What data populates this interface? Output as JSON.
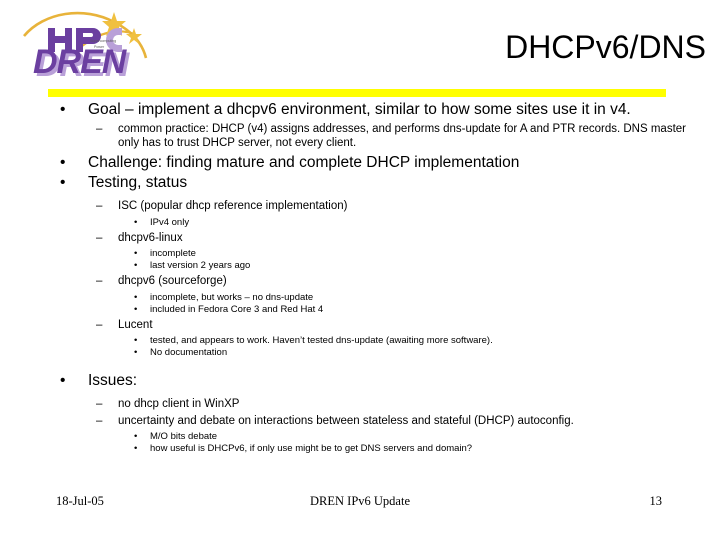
{
  "slide": {
    "title": "DHCPv6/DNS",
    "logo": {
      "primary_text": "DREN",
      "secondary_text": "HPC",
      "tagline_line1": "Supercomputing",
      "tagline_line2": "Power",
      "arc_color": "#E8B33A",
      "star_color": "#F0C040",
      "letter_color": "#6B3FA0",
      "letter_shadow_color": "#B9A0D8"
    },
    "rule_color": "#ffff00",
    "bullets": [
      {
        "level": 1,
        "marker": "•",
        "text": "Goal – implement a dhcpv6 environment, similar to how some sites use it in v4."
      },
      {
        "level": 2,
        "marker": "–",
        "text": "common practice:  DHCP (v4) assigns addresses, and performs dns-update for A and PTR records.  DNS master only has to trust DHCP server, not every client."
      },
      {
        "level": 1,
        "marker": "•",
        "text": "Challenge:  finding mature and complete DHCP implementation"
      },
      {
        "level": 1,
        "marker": "•",
        "text": "Testing, status"
      },
      {
        "level": 2,
        "marker": "–",
        "text": "ISC (popular dhcp reference implementation)"
      },
      {
        "level": 3,
        "marker": "•",
        "text": "IPv4 only"
      },
      {
        "level": 2,
        "marker": "–",
        "text": "dhcpv6-linux"
      },
      {
        "level": 3,
        "marker": "•",
        "text": "incomplete"
      },
      {
        "level": 3,
        "marker": "•",
        "text": "last version 2 years ago"
      },
      {
        "level": 2,
        "marker": "–",
        "text": "dhcpv6 (sourceforge)"
      },
      {
        "level": 3,
        "marker": "•",
        "text": "incomplete, but works – no dns-update"
      },
      {
        "level": 3,
        "marker": "•",
        "text": "included in Fedora Core 3 and Red Hat 4"
      },
      {
        "level": 2,
        "marker": "–",
        "text": "Lucent"
      },
      {
        "level": 3,
        "marker": "•",
        "text": "tested, and appears to work.  Haven’t tested dns-update (awaiting more software)."
      },
      {
        "level": 3,
        "marker": "•",
        "text": "No documentation"
      },
      {
        "level": 1,
        "marker": "•",
        "text": "Issues:"
      },
      {
        "level": 2,
        "marker": "–",
        "text": "no dhcp client in WinXP"
      },
      {
        "level": 2,
        "marker": "–",
        "text": "uncertainty and debate on interactions between stateless and stateful (DHCP) autoconfig."
      },
      {
        "level": 3,
        "marker": "•",
        "text": "M/O bits debate"
      },
      {
        "level": 3,
        "marker": "•",
        "text": "how useful is DHCPv6, if only use might be to get DNS servers and domain?"
      }
    ],
    "footer": {
      "date": "18-Jul-05",
      "center": "DREN IPv6 Update",
      "page": "13"
    }
  }
}
